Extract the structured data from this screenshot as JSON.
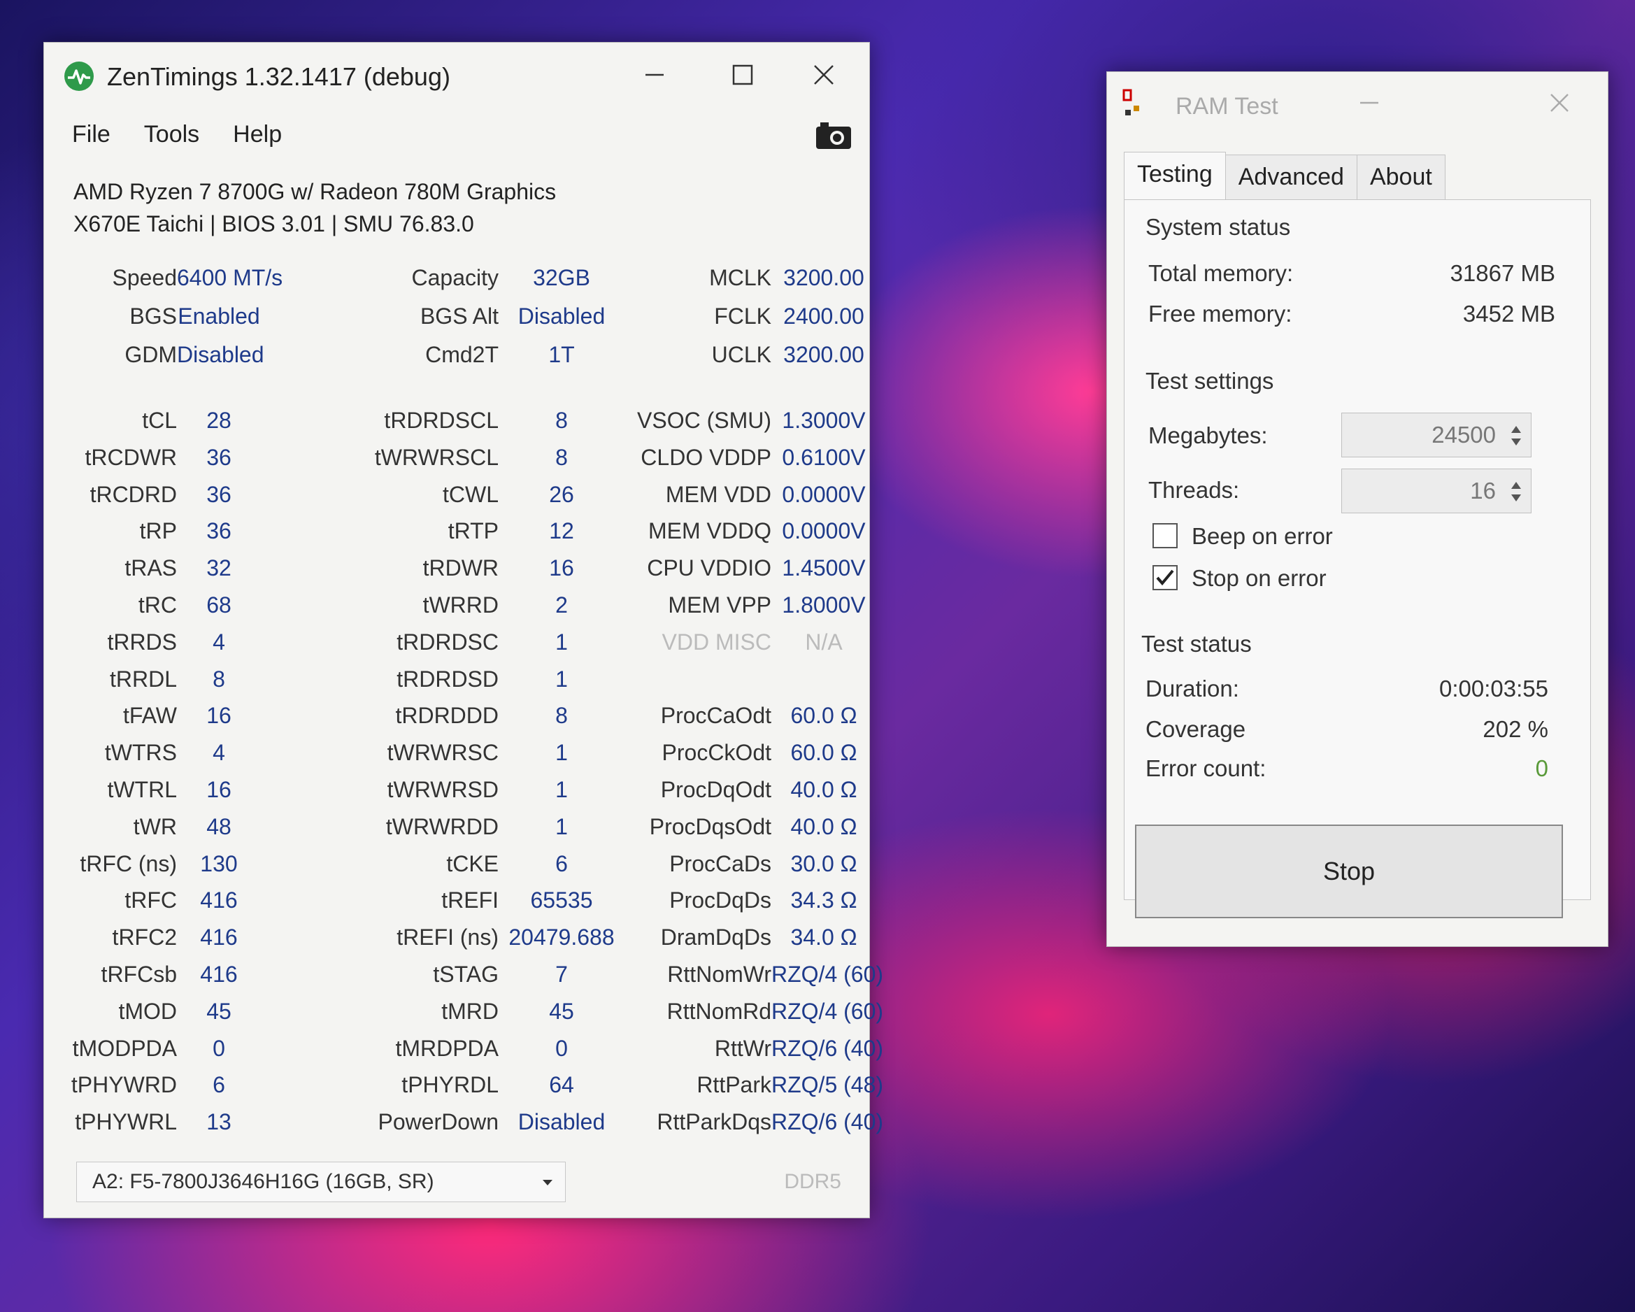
{
  "zentimings": {
    "title": "ZenTimings 1.32.1417 (debug)",
    "menu": [
      "File",
      "Tools",
      "Help"
    ],
    "cpu_name": "AMD Ryzen 7 8700G w/ Radeon 780M Graphics",
    "board_info": "X670E Taichi | BIOS 3.01 | SMU 76.83.0",
    "summary": [
      [
        [
          "Speed",
          "6400 MT/s"
        ],
        [
          "Capacity",
          "32GB"
        ],
        [
          "MCLK",
          "3200.00"
        ]
      ],
      [
        [
          "BGS",
          "Enabled"
        ],
        [
          "BGS Alt",
          "Disabled"
        ],
        [
          "FCLK",
          "2400.00"
        ]
      ],
      [
        [
          "GDM",
          "Disabled"
        ],
        [
          "Cmd2T",
          "1T"
        ],
        [
          "UCLK",
          "3200.00"
        ]
      ]
    ],
    "timings": [
      [
        [
          "tCL",
          "28"
        ],
        [
          "tRDRDSCL",
          "8"
        ],
        [
          "VSOC (SMU)",
          "1.3000V"
        ]
      ],
      [
        [
          "tRCDWR",
          "36"
        ],
        [
          "tWRWRSCL",
          "8"
        ],
        [
          "CLDO VDDP",
          "0.6100V"
        ]
      ],
      [
        [
          "tRCDRD",
          "36"
        ],
        [
          "tCWL",
          "26"
        ],
        [
          "MEM VDD",
          "0.0000V"
        ]
      ],
      [
        [
          "tRP",
          "36"
        ],
        [
          "tRTP",
          "12"
        ],
        [
          "MEM VDDQ",
          "0.0000V"
        ]
      ],
      [
        [
          "tRAS",
          "32"
        ],
        [
          "tRDWR",
          "16"
        ],
        [
          "CPU VDDIO",
          "1.4500V"
        ]
      ],
      [
        [
          "tRC",
          "68"
        ],
        [
          "tWRRD",
          "2"
        ],
        [
          "MEM VPP",
          "1.8000V"
        ]
      ],
      [
        [
          "tRRDS",
          "4"
        ],
        [
          "tRDRDSC",
          "1"
        ],
        [
          "VDD MISC",
          "N/A"
        ]
      ],
      [
        [
          "tRRDL",
          "8"
        ],
        [
          "tRDRDSD",
          "1"
        ],
        [
          "",
          ""
        ]
      ],
      [
        [
          "tFAW",
          "16"
        ],
        [
          "tRDRDDD",
          "8"
        ],
        [
          "ProcCaOdt",
          "60.0 Ω"
        ]
      ],
      [
        [
          "tWTRS",
          "4"
        ],
        [
          "tWRWRSC",
          "1"
        ],
        [
          "ProcCkOdt",
          "60.0 Ω"
        ]
      ],
      [
        [
          "tWTRL",
          "16"
        ],
        [
          "tWRWRSD",
          "1"
        ],
        [
          "ProcDqOdt",
          "40.0 Ω"
        ]
      ],
      [
        [
          "tWR",
          "48"
        ],
        [
          "tWRWRDD",
          "1"
        ],
        [
          "ProcDqsOdt",
          "40.0 Ω"
        ]
      ],
      [
        [
          "tRFC (ns)",
          "130"
        ],
        [
          "tCKE",
          "6"
        ],
        [
          "ProcCaDs",
          "30.0 Ω"
        ]
      ],
      [
        [
          "tRFC",
          "416"
        ],
        [
          "tREFI",
          "65535"
        ],
        [
          "ProcDqDs",
          "34.3 Ω"
        ]
      ],
      [
        [
          "tRFC2",
          "416"
        ],
        [
          "tREFI (ns)",
          "20479.688"
        ],
        [
          "DramDqDs",
          "34.0 Ω"
        ]
      ],
      [
        [
          "tRFCsb",
          "416"
        ],
        [
          "tSTAG",
          "7"
        ],
        [
          "RttNomWr",
          "RZQ/4 (60)"
        ]
      ],
      [
        [
          "tMOD",
          "45"
        ],
        [
          "tMRD",
          "45"
        ],
        [
          "RttNomRd",
          "RZQ/4 (60)"
        ]
      ],
      [
        [
          "tMODPDA",
          "0"
        ],
        [
          "tMRDPDA",
          "0"
        ],
        [
          "RttWr",
          "RZQ/6 (40)"
        ]
      ],
      [
        [
          "tPHYWRD",
          "6"
        ],
        [
          "tPHYRDL",
          "64"
        ],
        [
          "RttPark",
          "RZQ/5 (48)"
        ]
      ],
      [
        [
          "tPHYWRL",
          "13"
        ],
        [
          "PowerDown",
          "Disabled"
        ],
        [
          "RttParkDqs",
          "RZQ/6 (40)"
        ]
      ]
    ],
    "module_select": "A2: F5-7800J3646H16G (16GB, SR)",
    "memory_type": "DDR5"
  },
  "ramtest": {
    "title": "RAM Test",
    "tabs": [
      "Testing",
      "Advanced",
      "About"
    ],
    "system_status": {
      "heading": "System status",
      "total_label": "Total memory:",
      "total_value": "31867 MB",
      "free_label": "Free memory:",
      "free_value": "3452 MB"
    },
    "test_settings": {
      "heading": "Test settings",
      "megabytes_label": "Megabytes:",
      "megabytes_value": "24500",
      "threads_label": "Threads:",
      "threads_value": "16",
      "beep_label": "Beep on error",
      "beep_checked": false,
      "stop_label": "Stop on error",
      "stop_checked": true
    },
    "test_status": {
      "heading": "Test status",
      "duration_label": "Duration:",
      "duration_value": "0:00:03:55",
      "coverage_label": "Coverage",
      "coverage_value": "202 %",
      "errors_label": "Error count:",
      "errors_value": "0"
    },
    "stop_button": "Stop"
  },
  "colors": {
    "value_text": "#1e3a8a",
    "error_count": "#5a9a3a",
    "zen_icon": "#2e9a4a"
  },
  "icons": [
    "activity-icon",
    "minimize-icon",
    "maximize-icon",
    "close-icon",
    "camera-icon",
    "chevron-down-icon",
    "spin-arrows-icon",
    "checkmark-icon"
  ]
}
